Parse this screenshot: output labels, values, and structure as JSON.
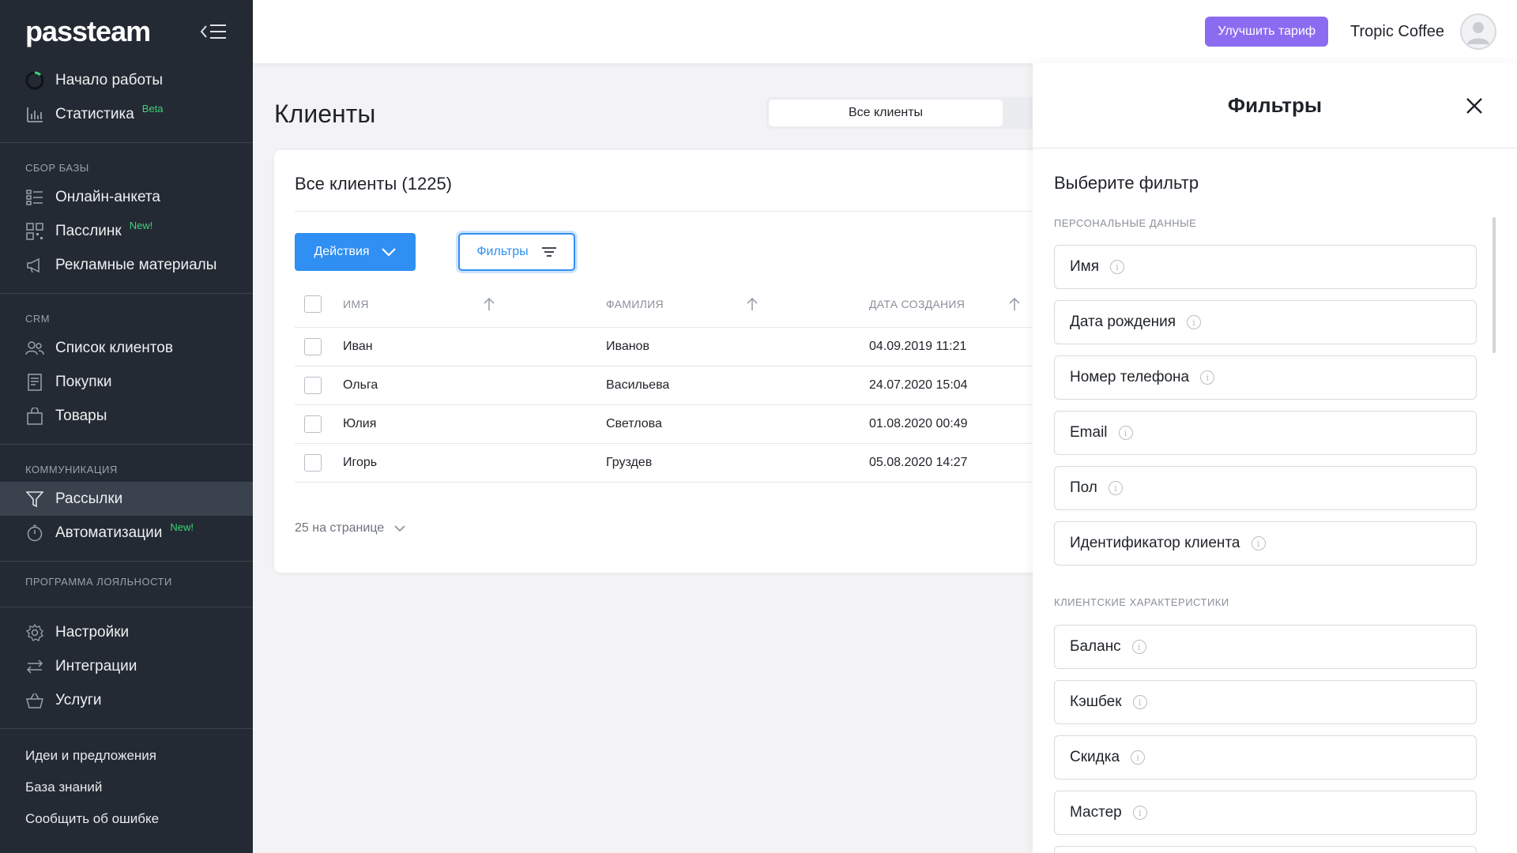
{
  "sidebar": {
    "logo": "passteam",
    "top_items": [
      {
        "label": "Начало работы"
      },
      {
        "label": "Статистика",
        "badge": "Beta"
      }
    ],
    "groups": [
      {
        "title": "СБОР БАЗЫ",
        "items": [
          {
            "label": "Онлайн-анкета"
          },
          {
            "label": "Пасслинк",
            "badge": "New!"
          },
          {
            "label": "Рекламные материалы"
          }
        ]
      },
      {
        "title": "CRM",
        "items": [
          {
            "label": "Список клиентов"
          },
          {
            "label": "Покупки"
          },
          {
            "label": "Товары"
          }
        ]
      },
      {
        "title": "КОММУНИКАЦИЯ",
        "items": [
          {
            "label": "Рассылки",
            "active": true
          },
          {
            "label": "Автоматизации",
            "badge": "New!"
          }
        ]
      },
      {
        "title": "ПРОГРАММА ЛОЯЛЬНОСТИ",
        "items": []
      }
    ],
    "bottom_items": [
      {
        "label": "Настройки"
      },
      {
        "label": "Интеграции"
      },
      {
        "label": "Услуги"
      }
    ],
    "links": [
      "Идеи и предложения",
      "База знаний",
      "Сообщить об ошибке"
    ]
  },
  "topbar": {
    "upgrade_label": "Улучшить тариф",
    "company": "Tropic Coffee"
  },
  "main": {
    "title": "Клиенты",
    "segment_label": "Все клиенты",
    "card_title": "Все клиенты (1225)",
    "actions_label": "Действия",
    "filters_label": "Фильтры",
    "columns": [
      "ИМЯ",
      "ФАМИЛИЯ",
      "ДАТА СОЗДАНИЯ"
    ],
    "rows": [
      {
        "first": "Иван",
        "last": "Иванов",
        "created": "04.09.2019 11:21"
      },
      {
        "first": "Ольга",
        "last": "Васильева",
        "created": "24.07.2020 15:04"
      },
      {
        "first": "Юлия",
        "last": "Светлова",
        "created": "01.08.2020 00:49"
      },
      {
        "first": "Игорь",
        "last": "Груздев",
        "created": "05.08.2020 14:27"
      }
    ],
    "per_page": "25 на странице"
  },
  "filters_panel": {
    "title": "Фильтры",
    "subtitle": "Выберите фильтр",
    "sections": [
      {
        "label": "ПЕРСОНАЛЬНЫЕ ДАННЫЕ",
        "options": [
          "Имя",
          "Дата рождения",
          "Номер телефона",
          "Email",
          "Пол",
          "Идентификатор клиента"
        ]
      },
      {
        "label": "КЛИЕНТСКИЕ ХАРАКТЕРИСТИКИ",
        "options": [
          "Баланс",
          "Кэшбек",
          "Скидка",
          "Мастер"
        ]
      }
    ]
  },
  "colors": {
    "sidebar_bg": "#232a33",
    "accent": "#2f8ff2",
    "upgrade": "#8b6cf0",
    "badge": "#3fd17a"
  }
}
